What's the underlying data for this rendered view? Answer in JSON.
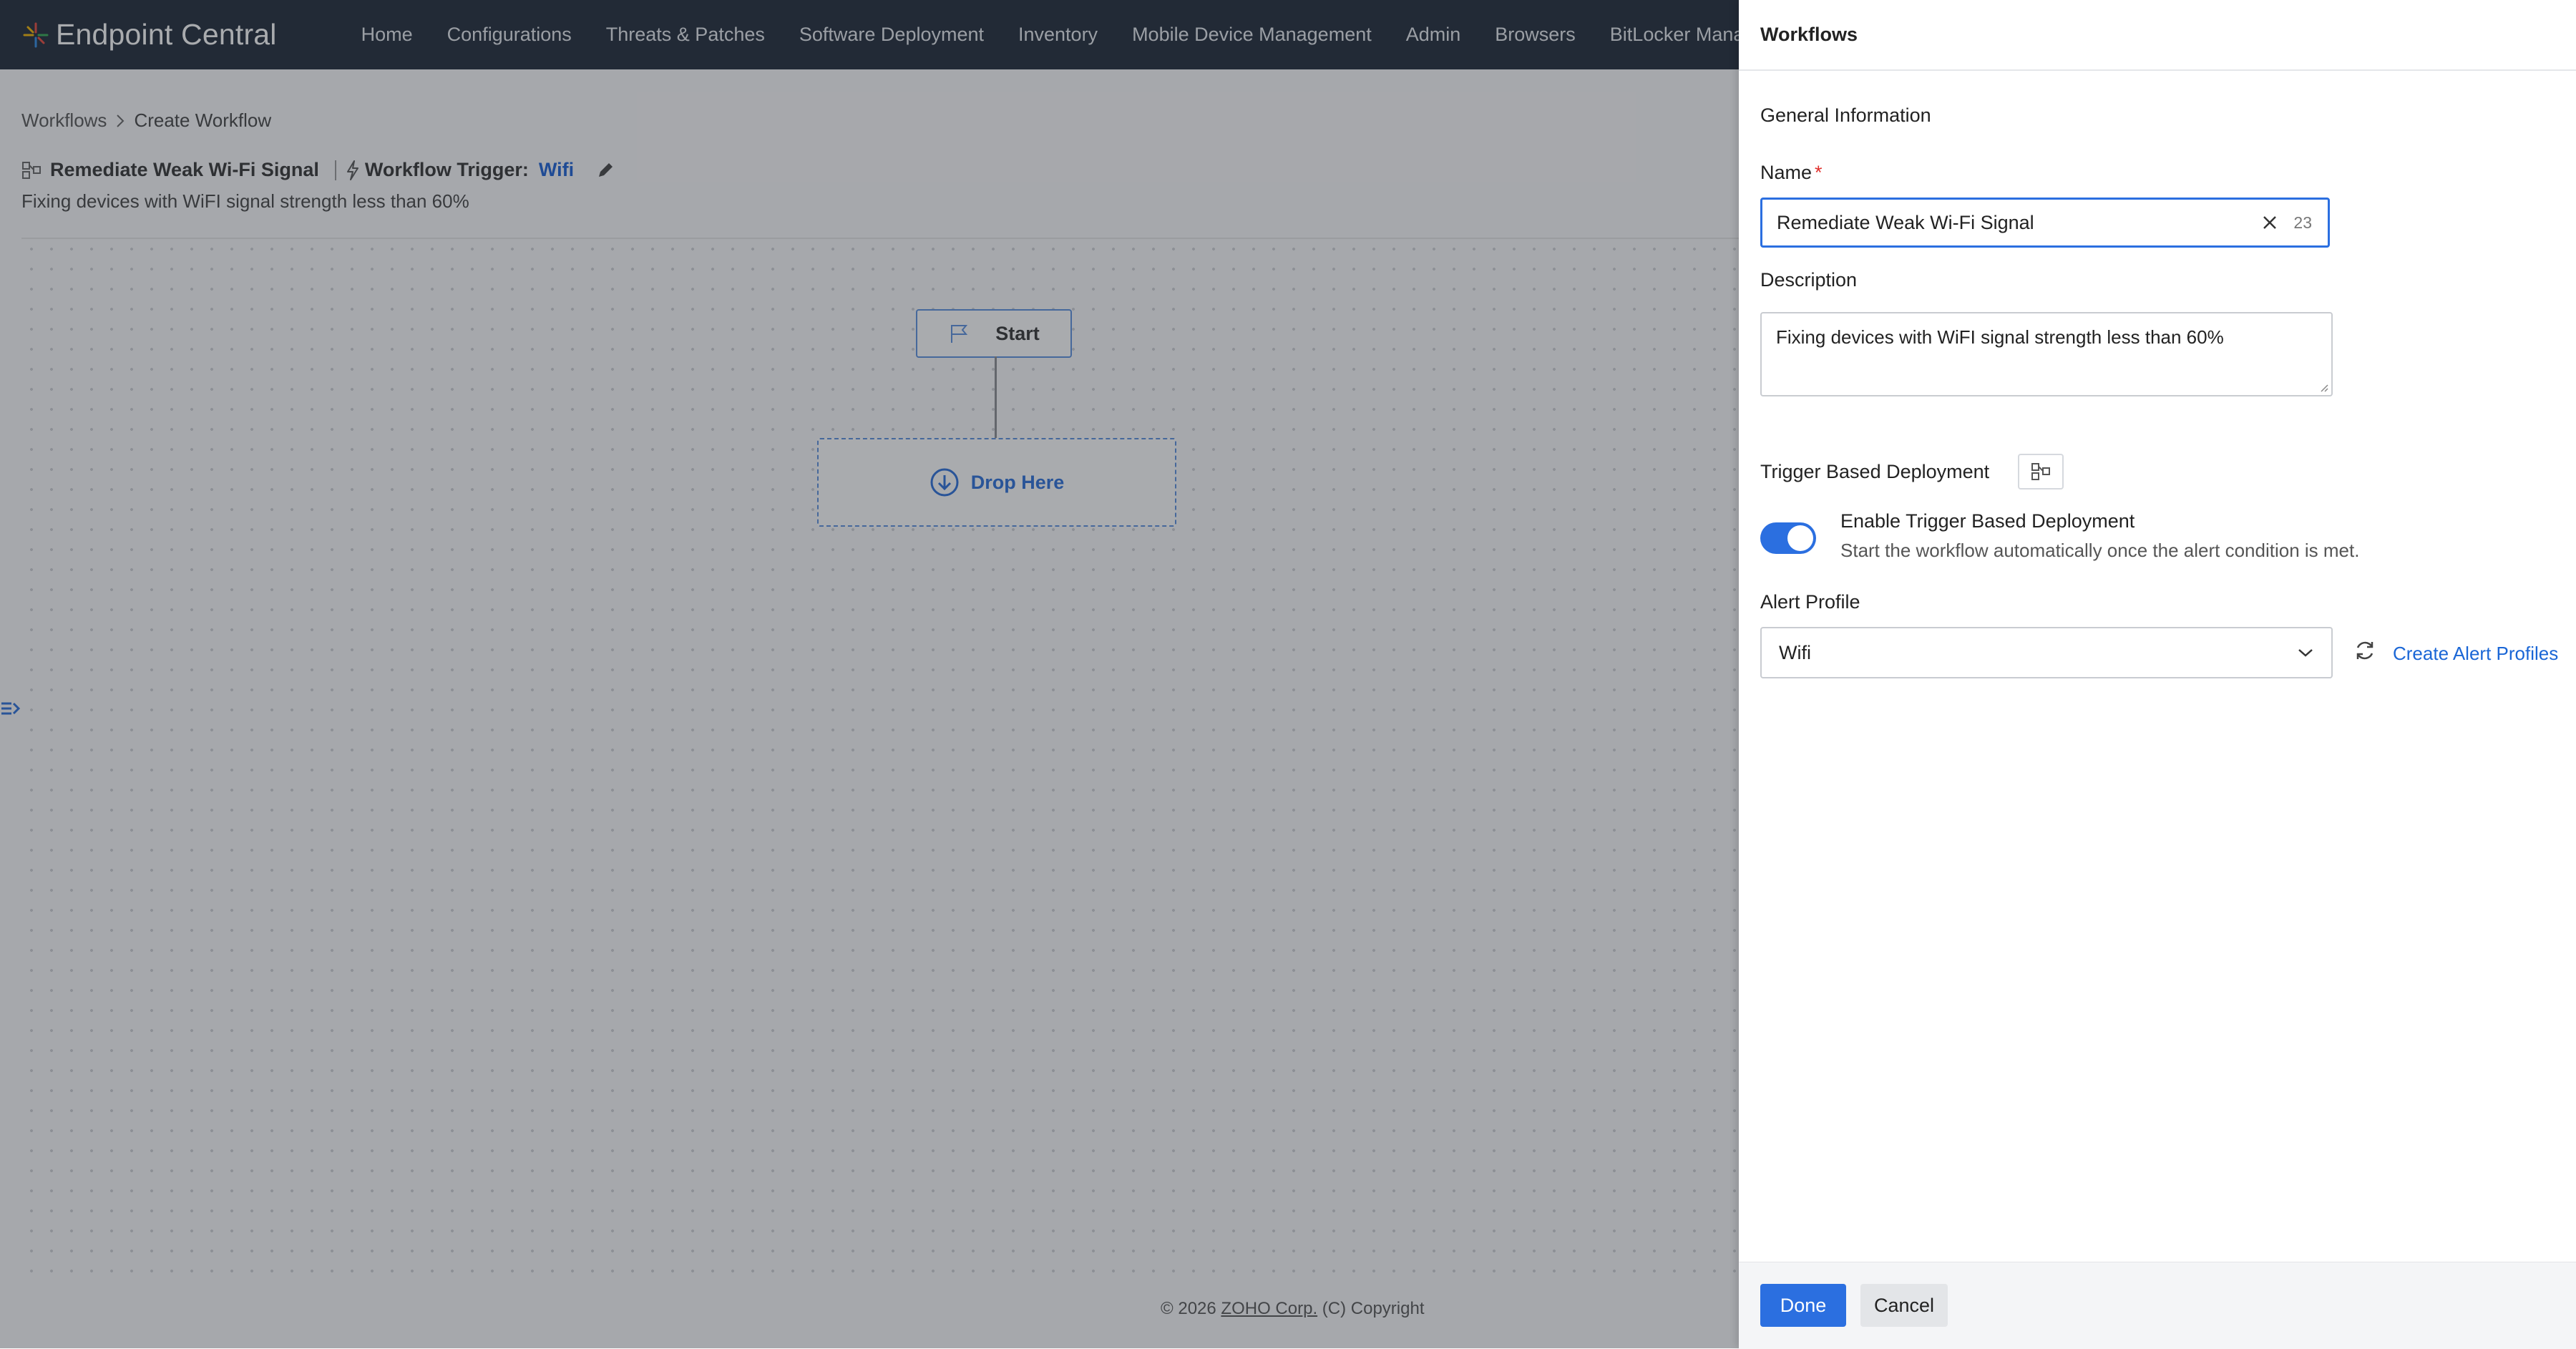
{
  "app": {
    "logo_text": "Endpoint Central",
    "nav": [
      "Home",
      "Configurations",
      "Threats & Patches",
      "Software Deployment",
      "Inventory",
      "Mobile Device Management",
      "Admin",
      "Browsers",
      "BitLocker Manager"
    ]
  },
  "breadcrumb": {
    "root": "Workflows",
    "current": "Create Workflow"
  },
  "workflow": {
    "name": "Remediate Weak Wi-Fi Signal",
    "trigger_label": "Workflow Trigger:",
    "trigger_value": "Wifi",
    "description": "Fixing devices with WiFI signal strength less than 60%"
  },
  "canvas": {
    "start_label": "Start",
    "drop_label": "Drop Here"
  },
  "footer": {
    "prefix": "© 2026",
    "company": "ZOHO Corp.",
    "suffix": "(C) Copyright"
  },
  "panel": {
    "title": "Workflows",
    "section": "General Information",
    "name_label": "Name",
    "required_mark": "*",
    "name_value": "Remediate Weak Wi-Fi Signal",
    "name_count": "23",
    "description_label": "Description",
    "description_value": "Fixing devices with WiFI signal strength less than 60%",
    "tbd_label": "Trigger Based Deployment",
    "toggle_title": "Enable Trigger Based Deployment",
    "toggle_desc": "Start the workflow automatically once the alert condition is met.",
    "toggle_on": true,
    "alert_label": "Alert Profile",
    "alert_value": "Wifi",
    "create_link": "Create Alert Profiles",
    "done": "Done",
    "cancel": "Cancel",
    "accent": "#2b6fe0"
  }
}
